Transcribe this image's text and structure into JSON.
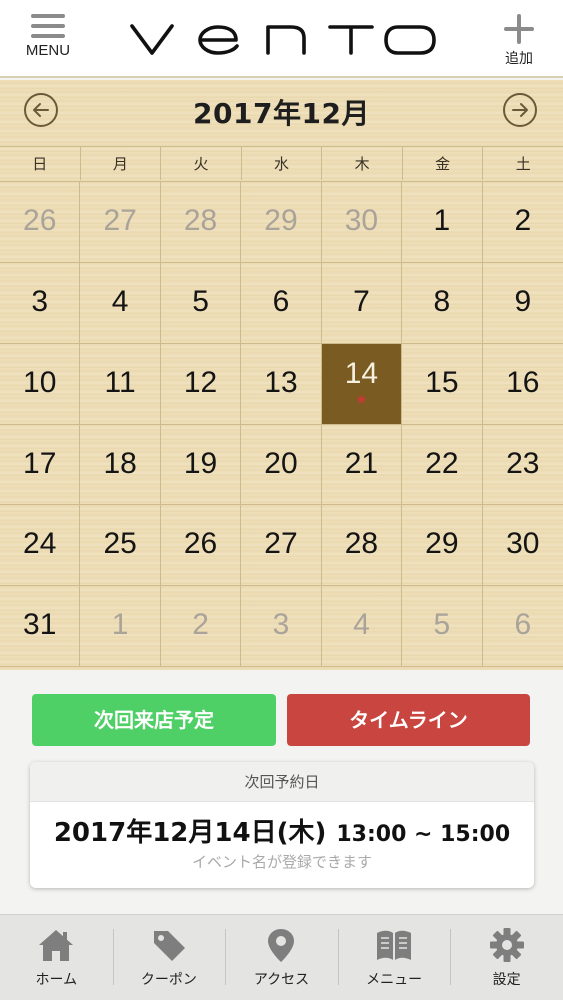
{
  "header": {
    "menu_label": "MENU",
    "logo_text": "VENTO",
    "add_label": "追加"
  },
  "calendar": {
    "month_title": "2017年12月",
    "weekdays": [
      "日",
      "月",
      "火",
      "水",
      "木",
      "金",
      "土"
    ],
    "weeks": [
      [
        {
          "d": "26",
          "muted": true
        },
        {
          "d": "27",
          "muted": true
        },
        {
          "d": "28",
          "muted": true
        },
        {
          "d": "29",
          "muted": true
        },
        {
          "d": "30",
          "muted": true
        },
        {
          "d": "1"
        },
        {
          "d": "2"
        }
      ],
      [
        {
          "d": "3"
        },
        {
          "d": "4"
        },
        {
          "d": "5"
        },
        {
          "d": "6"
        },
        {
          "d": "7"
        },
        {
          "d": "8"
        },
        {
          "d": "9"
        }
      ],
      [
        {
          "d": "10"
        },
        {
          "d": "11"
        },
        {
          "d": "12"
        },
        {
          "d": "13"
        },
        {
          "d": "14",
          "selected": true,
          "marker": "★"
        },
        {
          "d": "15"
        },
        {
          "d": "16"
        }
      ],
      [
        {
          "d": "17"
        },
        {
          "d": "18"
        },
        {
          "d": "19"
        },
        {
          "d": "20"
        },
        {
          "d": "21"
        },
        {
          "d": "22"
        },
        {
          "d": "23"
        }
      ],
      [
        {
          "d": "24"
        },
        {
          "d": "25"
        },
        {
          "d": "26"
        },
        {
          "d": "27"
        },
        {
          "d": "28"
        },
        {
          "d": "29"
        },
        {
          "d": "30"
        }
      ],
      [
        {
          "d": "31"
        },
        {
          "d": "1",
          "muted": true
        },
        {
          "d": "2",
          "muted": true
        },
        {
          "d": "3",
          "muted": true
        },
        {
          "d": "4",
          "muted": true
        },
        {
          "d": "5",
          "muted": true
        },
        {
          "d": "6",
          "muted": true
        }
      ]
    ]
  },
  "actions": {
    "next_visit_label": "次回来店予定",
    "timeline_label": "タイムライン"
  },
  "reservation": {
    "heading": "次回予約日",
    "date": "2017年12月14日(木)",
    "time": "13:00 ~ 15:00",
    "event_placeholder": "イベント名が登録できます"
  },
  "tabbar": [
    {
      "label": "ホーム",
      "icon": "home-icon"
    },
    {
      "label": "クーポン",
      "icon": "tag-icon"
    },
    {
      "label": "アクセス",
      "icon": "map-pin-icon"
    },
    {
      "label": "メニュー",
      "icon": "book-icon"
    },
    {
      "label": "設定",
      "icon": "gear-icon"
    }
  ],
  "colors": {
    "accent_green": "#4fd067",
    "accent_red": "#c9453f",
    "selected_day": "#7a5b22",
    "marker": "#c73a36"
  }
}
